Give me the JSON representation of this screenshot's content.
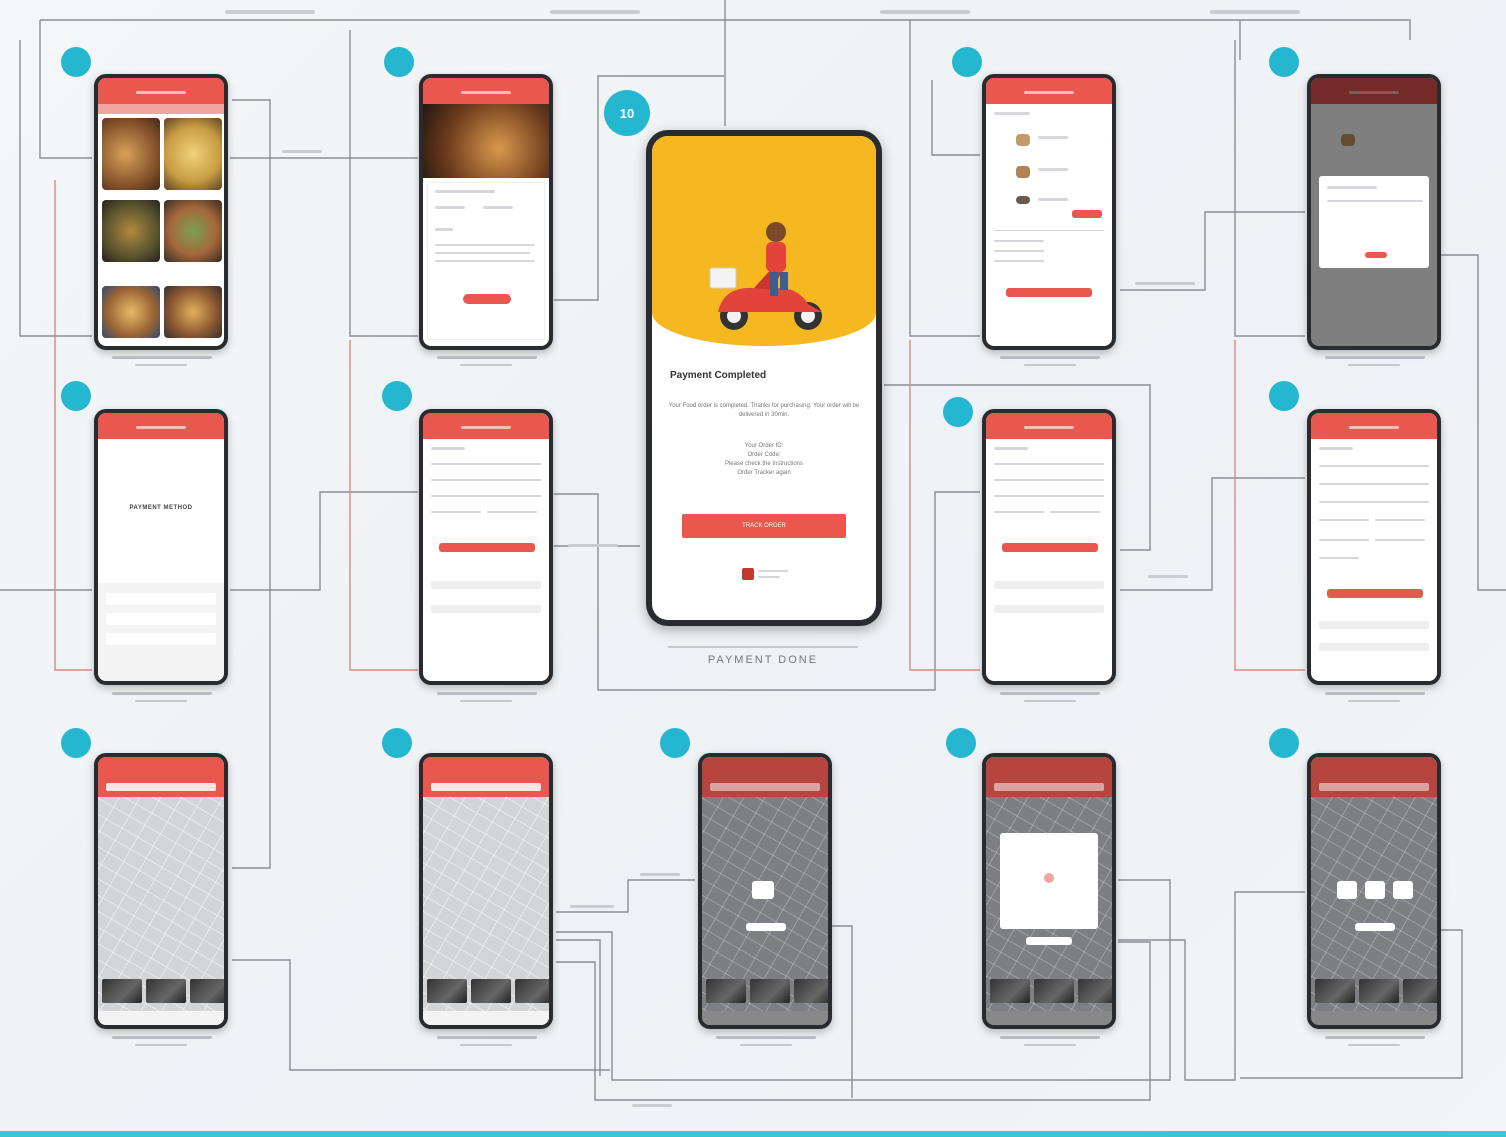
{
  "hero": {
    "title": "Payment Completed",
    "message": "Your Food order is completed. Thanks for purchasing. Your order will be delivered in 30min.",
    "order_lines": [
      "Your Order ID:",
      "Order Code:",
      "Please check the Instructions",
      "Order Tracker again"
    ],
    "button": "TRACK ORDER",
    "caption": "PAYMENT DONE"
  },
  "screens": {
    "payment_method_title": "PAYMENT METHOD"
  },
  "badges": {
    "hero": "10"
  },
  "colors": {
    "accent": "#e9574e",
    "badge": "#25b7cf",
    "hero_yellow": "#f6b820",
    "connector": "#8b8f96"
  },
  "icons": [
    "delivery-scooter-icon",
    "brand-logo-icon"
  ]
}
